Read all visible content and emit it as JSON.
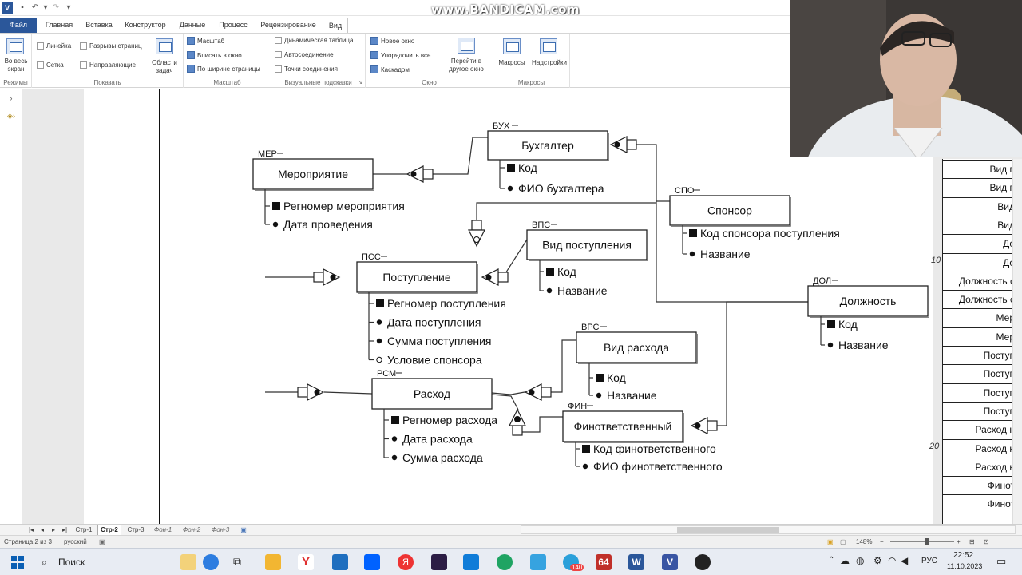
{
  "watermark": "www.BANDICAM.com",
  "quick_access": {
    "app_icon": "visio-icon",
    "save": "save-icon",
    "undo": "undo-icon",
    "redo": "redo-icon",
    "customize": "customize-icon"
  },
  "tabs": [
    "Файл",
    "Главная",
    "Вставка",
    "Конструктор",
    "Данные",
    "Процесс",
    "Рецензирование",
    "Вид"
  ],
  "ribbon": {
    "modes": {
      "button": "Во весь\nэкран",
      "label": "Режимы"
    },
    "show": {
      "ruler": "Линейка",
      "grid": "Сетка",
      "page_breaks": "Разрывы страниц",
      "guides": "Направляющие",
      "task_panes": "Области\nзадач",
      "label": "Показать"
    },
    "zoom": {
      "zoom": "Масштаб",
      "fit": "Вписать в окно",
      "page_width": "По ширине страницы",
      "label": "Масштаб"
    },
    "visual_aids": {
      "dynamic_grid": "Динамическая таблица",
      "autoconnect": "Автосоединение",
      "connection_points": "Точки соединения",
      "label": "Визуальные подсказки"
    },
    "window": {
      "new_window": "Новое окно",
      "arrange_all": "Упорядочить все",
      "cascade": "Каскадом",
      "switch": "Перейти в\nдругое окно",
      "label": "Окно"
    },
    "macros": {
      "macros": "Макросы",
      "addins": "Надстройки",
      "label": "Макросы"
    }
  },
  "entities": {
    "mer": {
      "code": "МЕР",
      "name": "Мероприятие",
      "attrs": [
        "Регномер мероприятия",
        "Дата проведения"
      ]
    },
    "buh": {
      "code": "БУХ",
      "name": "Бухгалтер",
      "attrs": [
        "Код",
        "ФИО бухгалтера"
      ]
    },
    "spo": {
      "code": "СПО",
      "name": "Спонсор",
      "attrs": [
        "Код спонсора поступления",
        "Название"
      ]
    },
    "vps": {
      "code": "ВПС",
      "name": "Вид поступления",
      "attrs": [
        "Код",
        "Название"
      ]
    },
    "pss": {
      "code": "ПСС",
      "name": "Поступление",
      "attrs": [
        "Регномер поступления",
        "Дата поступления",
        "Сумма поступления",
        "Условие спонсора"
      ]
    },
    "dol": {
      "code": "ДОЛ",
      "name": "Должность",
      "attrs": [
        "Код",
        "Название"
      ]
    },
    "vrs": {
      "code": "ВРС",
      "name": "Вид расхода",
      "attrs": [
        "Код",
        "Название"
      ]
    },
    "rsm": {
      "code": "РСМ",
      "name": "Расход",
      "attrs": [
        "Регномер расхода",
        "Дата расхода",
        "Сумма расхода"
      ]
    },
    "fin": {
      "code": "ФИН",
      "name": "Финответственный",
      "attrs": [
        "Код финответственного",
        "ФИО финответственного"
      ]
    }
  },
  "right_table": {
    "rows": [
      "Вид п",
      "Вид п",
      "Вид",
      "Вид",
      "До",
      "До",
      "Должность с",
      "Должность с",
      "Мер",
      "Мер",
      "Поступ",
      "Поступ",
      "Поступ",
      "Поступ",
      "Расход н",
      "Расход н",
      "Расход н",
      "Финот",
      "Финот"
    ],
    "row_numbers": [
      "10",
      "20"
    ]
  },
  "page_tabs": {
    "current": "Стр-2",
    "pages": [
      "Стр-1",
      "Стр-2",
      "Стр-3"
    ],
    "backgrounds": [
      "Фон-1",
      "Фон-2",
      "Фон-3"
    ]
  },
  "status": {
    "page": "Страница 2 из 3",
    "language": "русский",
    "zoom": "148%"
  },
  "taskbar": {
    "search": "Поиск",
    "badge_count": "140",
    "app_64": "64",
    "lang": "РУС",
    "time": "22:52",
    "date": "11.10.2023"
  }
}
